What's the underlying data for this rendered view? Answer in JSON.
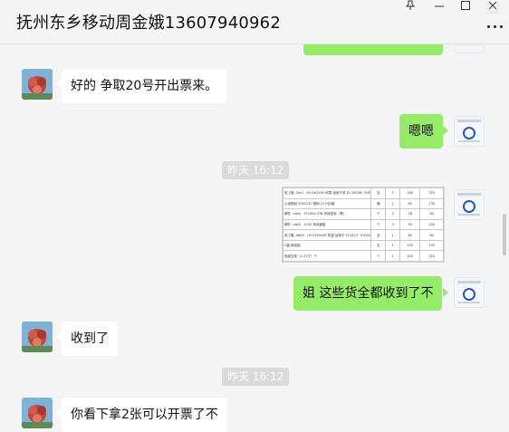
{
  "window": {
    "title": "抚州东乡移动周金娥13607940962",
    "pin_icon": "pin-icon",
    "minimize_icon": "minimize-icon",
    "maximize_icon": "maximize-icon",
    "close_icon": "close-icon",
    "more_icon": "more-icon"
  },
  "messages": [
    {
      "side": "left",
      "text": "好的 争取20号开出票来。"
    },
    {
      "side": "right",
      "text": "嗯嗯"
    },
    {
      "type": "time",
      "text": "昨天 16:12"
    },
    {
      "side": "right",
      "type": "image",
      "table": [
        [
          "电工箱（5m） HY-GH1430 耐寒 适用于风 EL-2002M（KIP-T119EC/BNC-T868）",
          "支",
          "2",
          "160",
          "320"
        ],
        [
          "心电图纸 ST61230 国网 2+2包/箱",
          "箱",
          "1",
          "65",
          "130"
        ],
        [
          "硬件（dell） ST1000 3TB 有线鼠标（黑）",
          "个",
          "3",
          "28",
          "84"
        ],
        [
          "硬件（dell） 2100 有线键盘",
          "个",
          "3",
          "50",
          "150"
        ],
        [
          "电工箱（680） HY-GF2006T 防盗 适用于 F1220-T（H2008T BUSV/B0208）",
          "支",
          "1",
          "80",
          "80"
        ],
        [
          "U盘 新技能",
          "支",
          "1",
          "155",
          "155"
        ],
        [
          "电缆支架（1-75寸）个",
          "个",
          "1",
          "320",
          "320"
        ]
      ]
    },
    {
      "side": "right",
      "text": "姐 这些货全都收到了不"
    },
    {
      "side": "left",
      "text": "收到了"
    },
    {
      "type": "time",
      "text": "昨天 16:12"
    },
    {
      "side": "left",
      "text": "你看下拿2张可以开票了不"
    }
  ]
}
